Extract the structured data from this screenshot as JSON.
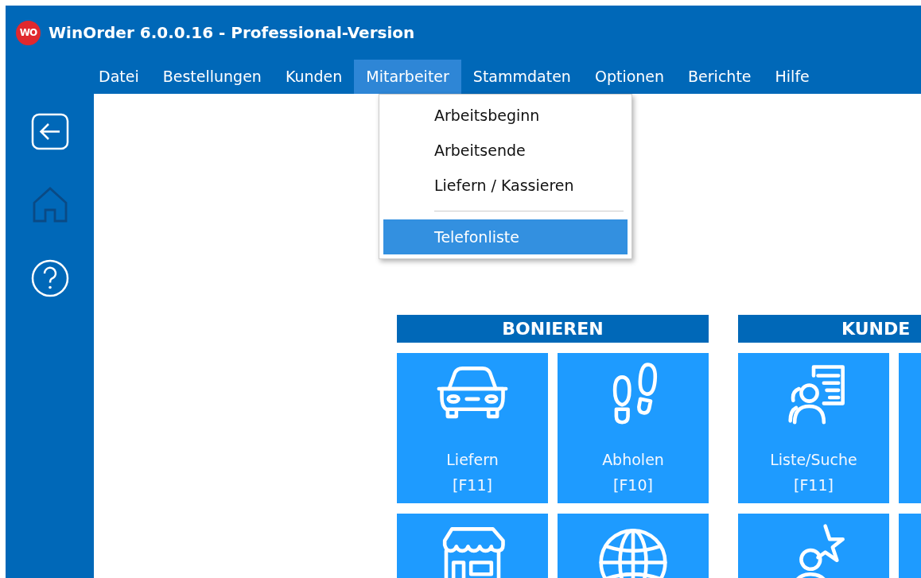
{
  "window": {
    "title": "WinOrder 6.0.0.16 - Professional-Version",
    "logo": "WO"
  },
  "menu_bar": [
    {
      "label": "Datei",
      "selected": false
    },
    {
      "label": "Bestellungen",
      "selected": false
    },
    {
      "label": "Kunden",
      "selected": false
    },
    {
      "label": "Mitarbeiter",
      "selected": true
    },
    {
      "label": "Stammdaten",
      "selected": false
    },
    {
      "label": "Optionen",
      "selected": false
    },
    {
      "label": "Berichte",
      "selected": false
    },
    {
      "label": "Hilfe",
      "selected": false
    }
  ],
  "dropdown": {
    "items": [
      {
        "kind": "item",
        "label": "Arbeitsbeginn",
        "selected": false
      },
      {
        "kind": "item",
        "label": "Arbeitsende",
        "selected": false
      },
      {
        "kind": "item",
        "label": "Liefern / Kassieren",
        "selected": false
      },
      {
        "kind": "separator"
      },
      {
        "kind": "item",
        "label": "Telefonliste",
        "selected": true
      }
    ]
  },
  "sidebar": [
    {
      "kind": "back",
      "disabled": false
    },
    {
      "kind": "home",
      "disabled": true
    },
    {
      "kind": "help",
      "disabled": false
    }
  ],
  "sections": [
    {
      "title": "BONIEREN",
      "tiles": [
        {
          "kind": "car",
          "label": "Liefern",
          "shortcut": "[F11]"
        },
        {
          "kind": "footprints",
          "label": "Abholen",
          "shortcut": "[F10]"
        },
        {
          "kind": "shop"
        },
        {
          "kind": "globe"
        }
      ]
    },
    {
      "title": "KUNDE",
      "tiles": [
        {
          "kind": "list",
          "label": "Liste/Suche",
          "shortcut": "[F11]"
        },
        {
          "kind": "blank"
        },
        {
          "kind": "star"
        },
        {
          "kind": "blank"
        }
      ]
    }
  ]
}
